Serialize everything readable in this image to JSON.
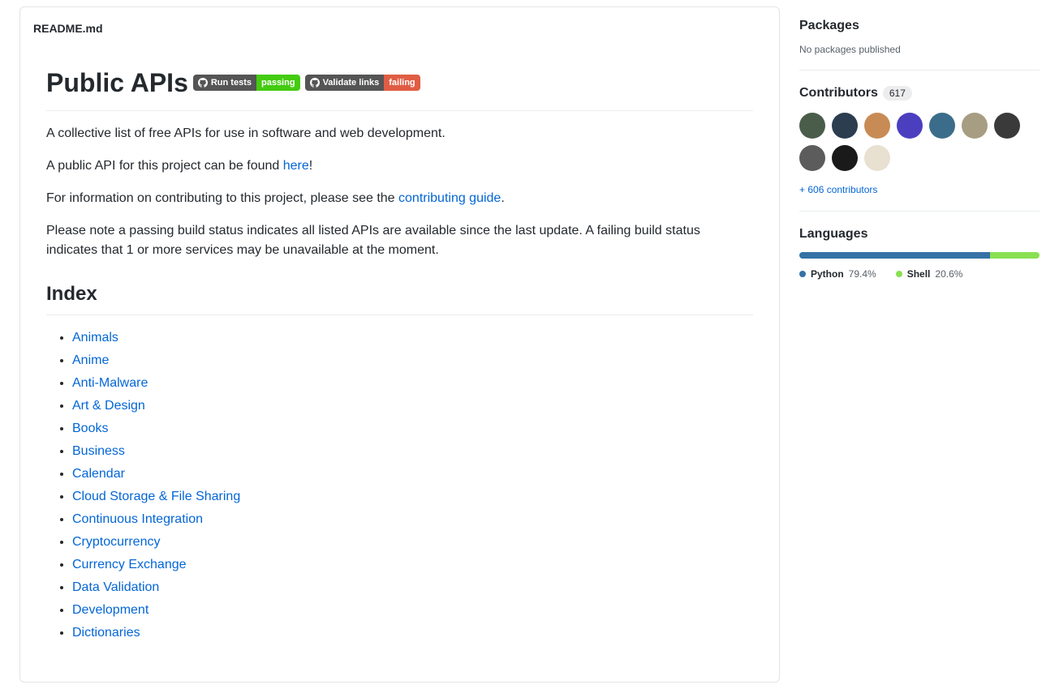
{
  "readme": {
    "filename": "README.md",
    "title": "Public APIs",
    "badges": {
      "tests": {
        "label": "Run tests",
        "status": "passing"
      },
      "links": {
        "label": "Validate links",
        "status": "failing"
      }
    },
    "intro": {
      "p1": "A collective list of free APIs for use in software and web development.",
      "p2_pre": "A public API for this project can be found ",
      "p2_link": "here",
      "p2_post": "!",
      "p3_pre": "For information on contributing to this project, please see the ",
      "p3_link": "contributing guide",
      "p3_post": ".",
      "p4": "Please note a passing build status indicates all listed APIs are available since the last update. A failing build status indicates that 1 or more services may be unavailable at the moment."
    },
    "index_heading": "Index",
    "index_items": [
      "Animals",
      "Anime",
      "Anti-Malware",
      "Art & Design",
      "Books",
      "Business",
      "Calendar",
      "Cloud Storage & File Sharing",
      "Continuous Integration",
      "Cryptocurrency",
      "Currency Exchange",
      "Data Validation",
      "Development",
      "Dictionaries"
    ]
  },
  "sidebar": {
    "packages": {
      "heading": "Packages",
      "none_text": "No packages published"
    },
    "contributors": {
      "heading": "Contributors",
      "count": "617",
      "avatar_colors": [
        "#4a5d4a",
        "#2b3d4f",
        "#c98b55",
        "#4b3fbf",
        "#3b6d8a",
        "#a79d82",
        "#3a3a3a",
        "#5c5c5c",
        "#1a1a1a",
        "#e8e0d0"
      ],
      "more_link": "+ 606 contributors"
    },
    "languages": {
      "heading": "Languages",
      "items": [
        {
          "name": "Python",
          "pct": "79.4%",
          "color": "#3572A5",
          "width": 79.4
        },
        {
          "name": "Shell",
          "pct": "20.6%",
          "color": "#89e051",
          "width": 20.6
        }
      ]
    }
  }
}
